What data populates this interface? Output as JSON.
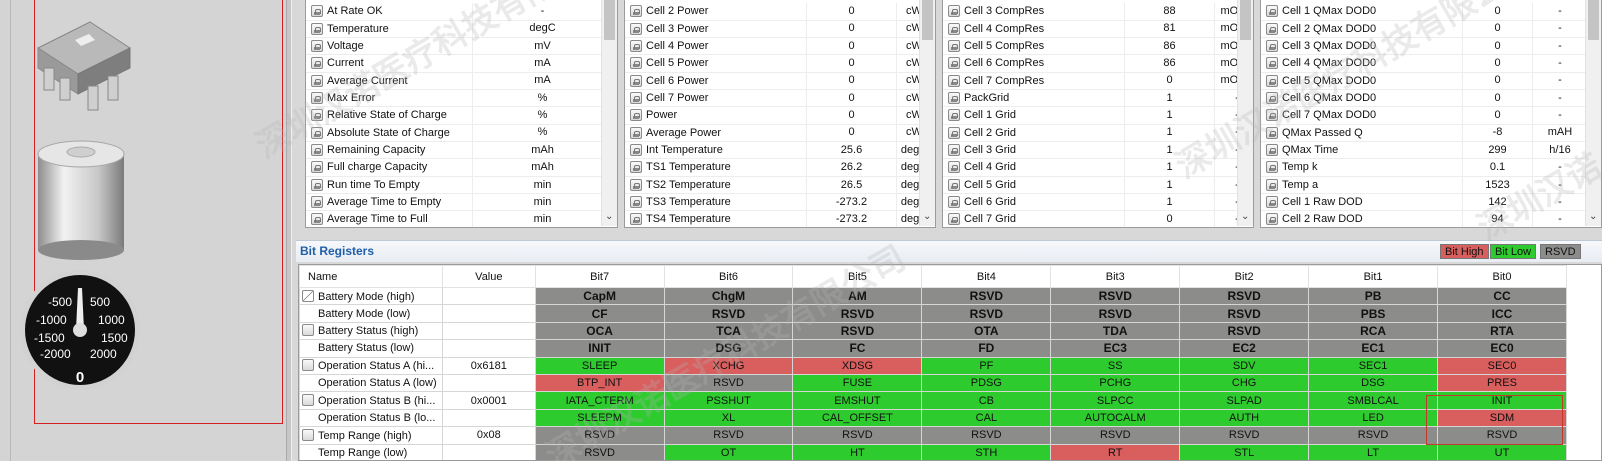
{
  "panels": [
    {
      "rows": [
        {
          "name": "At Rate OK",
          "value": "-",
          "unit": ""
        },
        {
          "name": "Temperature",
          "value": "degC",
          "unit": ""
        },
        {
          "name": "Voltage",
          "value": "mV",
          "unit": ""
        },
        {
          "name": "Current",
          "value": "mA",
          "unit": ""
        },
        {
          "name": "Average Current",
          "value": "mA",
          "unit": ""
        },
        {
          "name": "Max Error",
          "value": "%",
          "unit": ""
        },
        {
          "name": "Relative State of Charge",
          "value": "%",
          "unit": ""
        },
        {
          "name": "Absolute State of Charge",
          "value": "%",
          "unit": ""
        },
        {
          "name": "Remaining Capacity",
          "value": "mAh",
          "unit": ""
        },
        {
          "name": "Full charge Capacity",
          "value": "mAh",
          "unit": ""
        },
        {
          "name": "Run time To Empty",
          "value": "min",
          "unit": ""
        },
        {
          "name": "Average Time to Empty",
          "value": "min",
          "unit": ""
        },
        {
          "name": "Average Time to Full",
          "value": "min",
          "unit": ""
        }
      ]
    },
    {
      "rows": [
        {
          "name": "Cell 2 Power",
          "value": "0",
          "unit": "cW"
        },
        {
          "name": "Cell 3 Power",
          "value": "0",
          "unit": "cW"
        },
        {
          "name": "Cell 4 Power",
          "value": "0",
          "unit": "cW"
        },
        {
          "name": "Cell 5 Power",
          "value": "0",
          "unit": "cW"
        },
        {
          "name": "Cell 6 Power",
          "value": "0",
          "unit": "cW"
        },
        {
          "name": "Cell 7 Power",
          "value": "0",
          "unit": "cW"
        },
        {
          "name": "Power",
          "value": "0",
          "unit": "cW"
        },
        {
          "name": "Average Power",
          "value": "0",
          "unit": "cW"
        },
        {
          "name": "Int Temperature",
          "value": "25.6",
          "unit": "degC"
        },
        {
          "name": "TS1 Temperature",
          "value": "26.2",
          "unit": "degC"
        },
        {
          "name": "TS2 Temperature",
          "value": "26.5",
          "unit": "degC"
        },
        {
          "name": "TS3 Temperature",
          "value": "-273.2",
          "unit": "degC"
        },
        {
          "name": "TS4 Temperature",
          "value": "-273.2",
          "unit": "degC"
        }
      ]
    },
    {
      "rows": [
        {
          "name": "Cell 3 CompRes",
          "value": "88",
          "unit": "mOhm"
        },
        {
          "name": "Cell 4 CompRes",
          "value": "81",
          "unit": "mOhm"
        },
        {
          "name": "Cell 5 CompRes",
          "value": "86",
          "unit": "mOhm"
        },
        {
          "name": "Cell 6 CompRes",
          "value": "86",
          "unit": "mOhm"
        },
        {
          "name": "Cell 7 CompRes",
          "value": "0",
          "unit": "mOhm"
        },
        {
          "name": "PackGrid",
          "value": "1",
          "unit": "-"
        },
        {
          "name": "Cell 1 Grid",
          "value": "1",
          "unit": "-"
        },
        {
          "name": "Cell 2 Grid",
          "value": "1",
          "unit": "-"
        },
        {
          "name": "Cell 3 Grid",
          "value": "1",
          "unit": "-"
        },
        {
          "name": "Cell 4 Grid",
          "value": "1",
          "unit": "-"
        },
        {
          "name": "Cell 5 Grid",
          "value": "1",
          "unit": "-"
        },
        {
          "name": "Cell 6 Grid",
          "value": "1",
          "unit": "-"
        },
        {
          "name": "Cell 7 Grid",
          "value": "0",
          "unit": "-"
        }
      ]
    },
    {
      "rows": [
        {
          "name": "Cell 1 QMax DOD0",
          "value": "0",
          "unit": "-"
        },
        {
          "name": "Cell 2 QMax DOD0",
          "value": "0",
          "unit": "-"
        },
        {
          "name": "Cell 3 QMax DOD0",
          "value": "0",
          "unit": "-"
        },
        {
          "name": "Cell 4 QMax DOD0",
          "value": "0",
          "unit": "-"
        },
        {
          "name": "Cell 5 QMax DOD0",
          "value": "0",
          "unit": "-"
        },
        {
          "name": "Cell 6 QMax DOD0",
          "value": "0",
          "unit": "-"
        },
        {
          "name": "Cell 7 QMax DOD0",
          "value": "0",
          "unit": "-"
        },
        {
          "name": "QMax Passed Q",
          "value": "-8",
          "unit": "mAH"
        },
        {
          "name": "QMax Time",
          "value": "299",
          "unit": "h/16"
        },
        {
          "name": "Temp k",
          "value": "0.1",
          "unit": "-"
        },
        {
          "name": "Temp a",
          "value": "1523",
          "unit": "-"
        },
        {
          "name": "Cell 1 Raw DOD",
          "value": "142",
          "unit": "-"
        },
        {
          "name": "Cell 2 Raw DOD",
          "value": "94",
          "unit": "-"
        }
      ]
    }
  ],
  "bit_registers": {
    "title": "Bit Registers",
    "legend": {
      "high": "Bit High",
      "low": "Bit Low",
      "rsvd": "RSVD"
    },
    "colors": {
      "high": "#d95e5e",
      "low": "#2ecb2e",
      "rsvd": "#8c8c8a"
    },
    "columns": [
      "Name",
      "Value",
      "Bit7",
      "Bit6",
      "Bit5",
      "Bit4",
      "Bit3",
      "Bit2",
      "Bit1",
      "Bit0"
    ],
    "rows": [
      {
        "name": "Battery Mode (high)",
        "value": "",
        "icon": "edit",
        "bold": true,
        "bits": [
          [
            "CapM",
            "g"
          ],
          [
            "ChgM",
            "g"
          ],
          [
            "AM",
            "g"
          ],
          [
            "RSVD",
            "g"
          ],
          [
            "RSVD",
            "g"
          ],
          [
            "RSVD",
            "g"
          ],
          [
            "PB",
            "g"
          ],
          [
            "CC",
            "g"
          ]
        ]
      },
      {
        "name": "Battery Mode (low)",
        "value": "",
        "icon": "",
        "bold": true,
        "bits": [
          [
            "CF",
            "g"
          ],
          [
            "RSVD",
            "g"
          ],
          [
            "RSVD",
            "g"
          ],
          [
            "RSVD",
            "g"
          ],
          [
            "RSVD",
            "g"
          ],
          [
            "RSVD",
            "g"
          ],
          [
            "PBS",
            "g"
          ],
          [
            "ICC",
            "g"
          ]
        ]
      },
      {
        "name": "Battery Status (high)",
        "value": "",
        "icon": "lock",
        "bold": true,
        "bits": [
          [
            "OCA",
            "g"
          ],
          [
            "TCA",
            "g"
          ],
          [
            "RSVD",
            "g"
          ],
          [
            "OTA",
            "g"
          ],
          [
            "TDA",
            "g"
          ],
          [
            "RSVD",
            "g"
          ],
          [
            "RCA",
            "g"
          ],
          [
            "RTA",
            "g"
          ]
        ]
      },
      {
        "name": "Battery Status (low)",
        "value": "",
        "icon": "",
        "bold": true,
        "bits": [
          [
            "INIT",
            "g"
          ],
          [
            "DSG",
            "g"
          ],
          [
            "FC",
            "g"
          ],
          [
            "FD",
            "g"
          ],
          [
            "EC3",
            "g"
          ],
          [
            "EC2",
            "g"
          ],
          [
            "EC1",
            "g"
          ],
          [
            "EC0",
            "g"
          ]
        ]
      },
      {
        "name": "Operation Status A (hi...",
        "value": "0x6181",
        "icon": "lock",
        "bold": false,
        "bits": [
          [
            "SLEEP",
            "l"
          ],
          [
            "XCHG",
            "h"
          ],
          [
            "XDSG",
            "h"
          ],
          [
            "PF",
            "l"
          ],
          [
            "SS",
            "l"
          ],
          [
            "SDV",
            "l"
          ],
          [
            "SEC1",
            "l"
          ],
          [
            "SEC0",
            "h"
          ]
        ]
      },
      {
        "name": "Operation Status A (low)",
        "value": "",
        "icon": "",
        "bold": false,
        "bits": [
          [
            "BTP_INT",
            "h"
          ],
          [
            "RSVD",
            "g"
          ],
          [
            "FUSE",
            "l"
          ],
          [
            "PDSG",
            "l"
          ],
          [
            "PCHG",
            "l"
          ],
          [
            "CHG",
            "l"
          ],
          [
            "DSG",
            "l"
          ],
          [
            "PRES",
            "h"
          ]
        ]
      },
      {
        "name": "Operation Status B (hi...",
        "value": "0x0001",
        "icon": "lock",
        "bold": false,
        "bits": [
          [
            "IATA_CTERM",
            "l"
          ],
          [
            "PSSHUT",
            "l"
          ],
          [
            "EMSHUT",
            "l"
          ],
          [
            "CB",
            "l"
          ],
          [
            "SLPCC",
            "l"
          ],
          [
            "SLPAD",
            "l"
          ],
          [
            "SMBLCAL",
            "l"
          ],
          [
            "INIT",
            "l"
          ]
        ]
      },
      {
        "name": "Operation Status B (lo...",
        "value": "",
        "icon": "",
        "bold": false,
        "bits": [
          [
            "SLEEPM",
            "l"
          ],
          [
            "XL",
            "l"
          ],
          [
            "CAL_OFFSET",
            "l"
          ],
          [
            "CAL",
            "l"
          ],
          [
            "AUTOCALM",
            "l"
          ],
          [
            "AUTH",
            "l"
          ],
          [
            "LED",
            "l"
          ],
          [
            "SDM",
            "h"
          ]
        ]
      },
      {
        "name": "Temp Range (high)",
        "value": "0x08",
        "icon": "lock",
        "bold": false,
        "bits": [
          [
            "RSVD",
            "g"
          ],
          [
            "RSVD",
            "g"
          ],
          [
            "RSVD",
            "g"
          ],
          [
            "RSVD",
            "g"
          ],
          [
            "RSVD",
            "g"
          ],
          [
            "RSVD",
            "g"
          ],
          [
            "RSVD",
            "g"
          ],
          [
            "RSVD",
            "g"
          ]
        ]
      },
      {
        "name": "Temp Range (low)",
        "value": "",
        "icon": "",
        "bold": false,
        "bits": [
          [
            "RSVD",
            "g"
          ],
          [
            "OT",
            "l"
          ],
          [
            "HT",
            "l"
          ],
          [
            "STH",
            "l"
          ],
          [
            "RT",
            "h"
          ],
          [
            "STL",
            "l"
          ],
          [
            "LT",
            "l"
          ],
          [
            "UT",
            "l"
          ]
        ]
      }
    ]
  },
  "gauge": {
    "labels": [
      "-500",
      "500",
      "-1000",
      "1000",
      "-1500",
      "1500",
      "-2000",
      "2000"
    ],
    "value": "0"
  },
  "icons": [
    "chip-icon",
    "battery-icon",
    "gauge-icon"
  ],
  "watermarks": [
    "深圳汉诺医疗科技有限公司",
    "深圳汉诺医疗科技有限公司",
    "深圳汉诺",
    "深圳汉诺医疗科技有限公司"
  ]
}
